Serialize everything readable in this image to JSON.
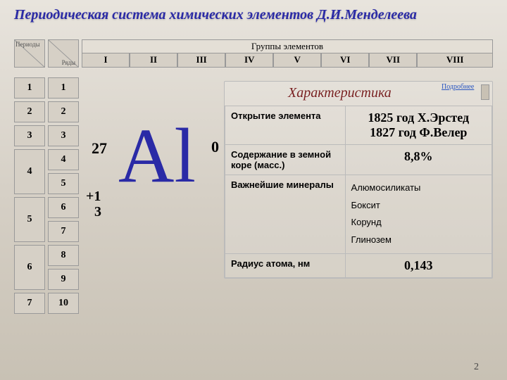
{
  "title": "Периодическая система химических элементов Д.И.Менделеева",
  "header": {
    "periods_label": "Периоды",
    "rows_label": "Ряды",
    "groups_label": "Группы элементов",
    "groups": [
      "I",
      "II",
      "III",
      "IV",
      "V",
      "VI",
      "VII",
      "VIII"
    ]
  },
  "periods": [
    "1",
    "2",
    "3",
    "4",
    "5",
    "6",
    "7"
  ],
  "rows": [
    "1",
    "2",
    "3",
    "4",
    "5",
    "6",
    "7",
    "8",
    "9",
    "10"
  ],
  "element": {
    "mass": "27",
    "symbol": "Al",
    "superscript": "0",
    "charge_line1": "+1",
    "charge_line2": "3"
  },
  "char": {
    "title": "Характеристика",
    "link": "Подробнее",
    "rows": [
      {
        "label": "Открытие элемента",
        "value": "1825 год Х.Эрстед",
        "value2": "1827 год Ф.Велер"
      },
      {
        "label": "Содержание в земной коре (масс.)",
        "value": "8,8%"
      },
      {
        "label": "Важнейшие минералы",
        "list": [
          "Алюмосиликаты",
          "Боксит",
          "Корунд",
          "Глинозем"
        ]
      },
      {
        "label": "Радиус атома, нм",
        "value": "0,143"
      }
    ]
  },
  "page": "2"
}
